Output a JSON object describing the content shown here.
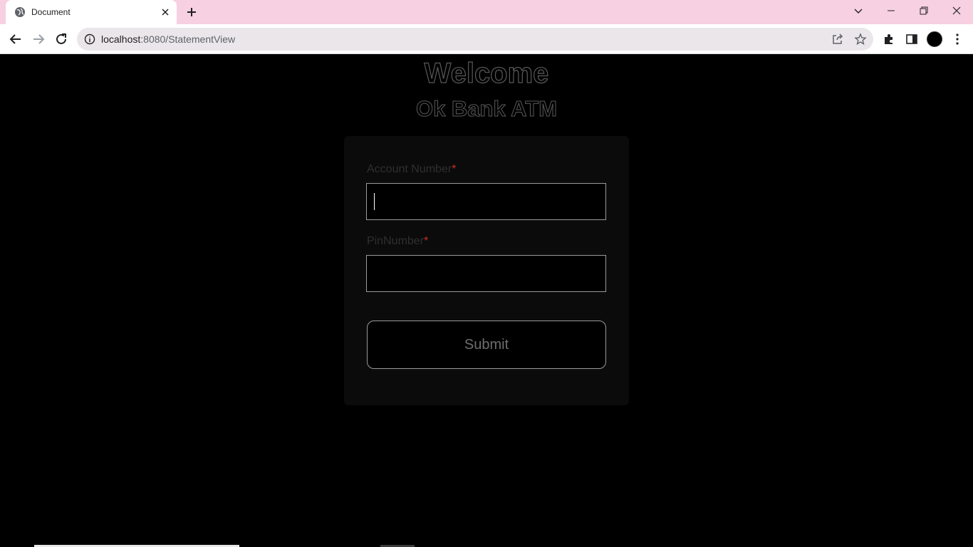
{
  "browser": {
    "tab_title": "Document",
    "url_host": "localhost",
    "url_path": ":8080/StatementView"
  },
  "page": {
    "heading": "Welcome",
    "subheading": "Ok Bank ATM",
    "form": {
      "account_label": "Account Number",
      "account_value": "",
      "pin_label": "PinNumber",
      "pin_value": "",
      "required_mark": "*",
      "submit_label": "Submit"
    }
  },
  "colors": {
    "tabbar": "#f7d0e1",
    "required": "#d12a2a",
    "page_bg": "#000000"
  },
  "icons": [
    "globe-icon",
    "close-icon",
    "plus-icon",
    "chevron-down-icon",
    "minimize-icon",
    "restore-icon",
    "close-window-icon",
    "back-icon",
    "forward-icon",
    "reload-icon",
    "info-icon",
    "share-icon",
    "star-icon",
    "extensions-icon",
    "side-panel-icon",
    "menu-icon"
  ]
}
